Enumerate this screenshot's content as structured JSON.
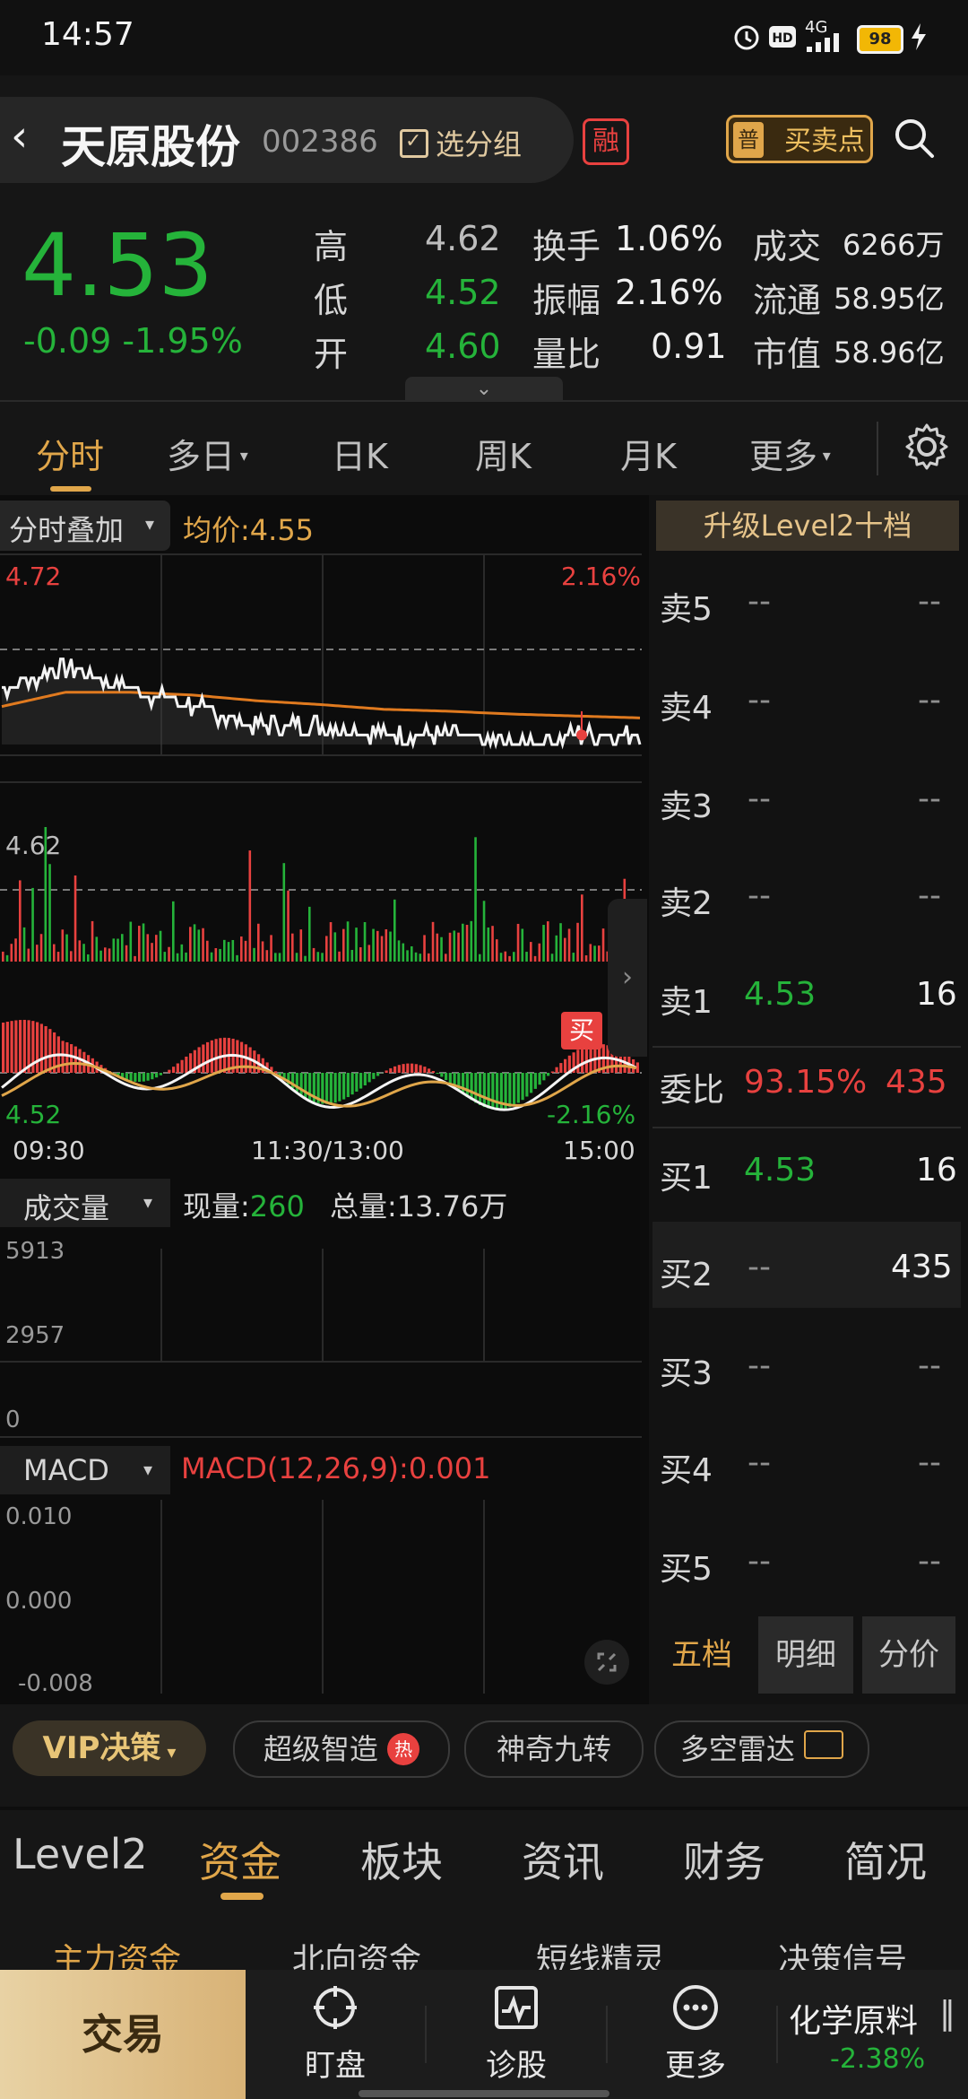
{
  "status": {
    "time": "14:57",
    "network": "4G",
    "battery": "98"
  },
  "header": {
    "back": "‹",
    "name": "天原股份",
    "code": "002386",
    "select_group": "选分组",
    "rong": "融",
    "buy_sell_points": "买卖点",
    "buy_sell_tag": "普"
  },
  "quote": {
    "price": "4.53",
    "change": "-0.09  -1.95%",
    "high_label": "高",
    "high": "4.62",
    "low_label": "低",
    "low": "4.52",
    "open_label": "开",
    "open": "4.60",
    "turnover_label": "换手",
    "turnover": "1.06%",
    "amplitude_label": "振幅",
    "amplitude": "2.16%",
    "volume_ratio_label": "量比",
    "volume_ratio": "0.91",
    "deal_label": "成交",
    "deal": "6266万",
    "float_label": "流通",
    "float": "58.95亿",
    "mktcap_label": "市值",
    "mktcap": "58.96亿"
  },
  "period_tabs": [
    {
      "label": "分时",
      "active": true
    },
    {
      "label": "多日"
    },
    {
      "label": "日K"
    },
    {
      "label": "周K"
    },
    {
      "label": "月K"
    },
    {
      "label": "更多"
    }
  ],
  "chart": {
    "overlay_label": "分时叠加",
    "avg_label": "均价:4.55",
    "top_price": "4.72",
    "top_pct": "2.16%",
    "mid_price": "4.62",
    "bottom_price": "4.52",
    "bottom_pct": "-2.16%",
    "time_start": "09:30",
    "time_mid": "11:30/13:00",
    "time_end": "15:00",
    "buy_marker": "买",
    "volume_label": "成交量",
    "cur_vol_label": "现量:",
    "cur_vol": "260",
    "total_vol": "总量:13.76万",
    "vol_top": "5913",
    "vol_mid": "2957",
    "vol_bottom": "0",
    "macd_label": "MACD",
    "macd_value": "MACD(12,26,9):0.001",
    "macd_top": "0.010",
    "macd_mid": "0.000",
    "macd_bottom": "-0.008"
  },
  "chart_data": {
    "type": "line",
    "series": [
      {
        "name": "均价",
        "values": [
          4.56,
          4.575,
          4.575,
          4.572,
          4.566,
          4.562,
          4.557,
          4.555,
          4.552,
          4.55,
          4.548
        ]
      },
      {
        "values": [
          4.58,
          4.6,
          4.58,
          4.56,
          4.54,
          4.54,
          4.53,
          4.53,
          4.52,
          4.53,
          4.53
        ]
      }
    ],
    "x": [
      "09:30",
      "11:30/13:00",
      "15:00"
    ],
    "ylim": [
      4.52,
      4.72
    ]
  },
  "orderbook": {
    "level2_btn": "升级Level2十档",
    "sells": [
      {
        "label": "卖5",
        "price": "--",
        "vol": "--"
      },
      {
        "label": "卖4",
        "price": "--",
        "vol": "--"
      },
      {
        "label": "卖3",
        "price": "--",
        "vol": "--"
      },
      {
        "label": "卖2",
        "price": "--",
        "vol": "--"
      },
      {
        "label": "卖1",
        "price": "4.53",
        "vol": "16"
      }
    ],
    "ratio_label": "委比",
    "ratio": "93.15%",
    "ratio_vol": "435",
    "buys": [
      {
        "label": "买1",
        "price": "4.53",
        "vol": "16"
      },
      {
        "label": "买2",
        "price": "--",
        "vol": "435"
      },
      {
        "label": "买3",
        "price": "--",
        "vol": "--"
      },
      {
        "label": "买4",
        "price": "--",
        "vol": "--"
      },
      {
        "label": "买5",
        "price": "--",
        "vol": "--"
      }
    ],
    "tabs": [
      "五档",
      "明细",
      "分价"
    ]
  },
  "chips": {
    "vip": "VIP决策",
    "items": [
      "超级智造",
      "神奇九转",
      "多空雷达"
    ],
    "hot": "热"
  },
  "bottom_tabs": [
    "Level2",
    "资金",
    "板块",
    "资讯",
    "财务",
    "简况"
  ],
  "sub_tabs": [
    "主力资金",
    "北向资金",
    "短线精灵",
    "决策信号"
  ],
  "nav": {
    "trade": "交易",
    "watch": "盯盘",
    "diagnose": "诊股",
    "more": "更多",
    "sector": "化学原料",
    "sector_change": "-2.38%"
  }
}
